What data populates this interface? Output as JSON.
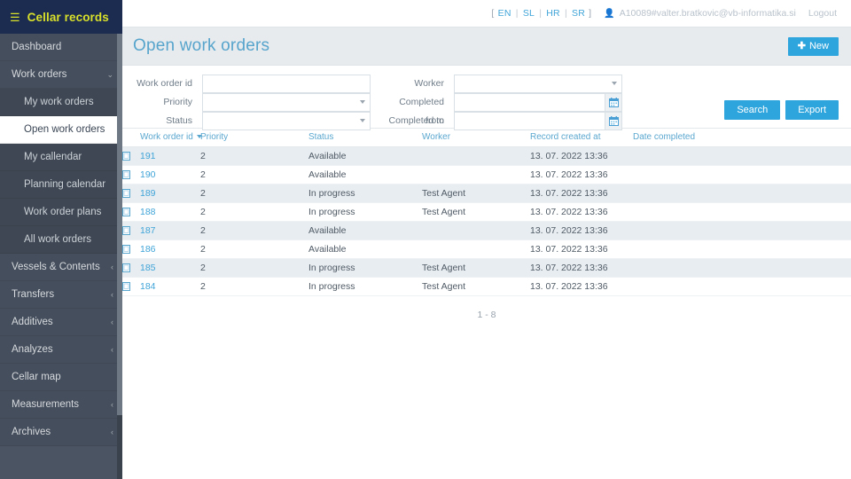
{
  "brand": {
    "menu_icon": "hamburger-icon",
    "title": "Cellar records",
    "color": "#d9e02a",
    "bg": "#1b2c50"
  },
  "sidebar": {
    "bg": "#4a5463",
    "active_bg": "#ffffff",
    "items": [
      {
        "label": "Dashboard",
        "level": 1,
        "caret": "",
        "active": false
      },
      {
        "label": "Work orders",
        "level": 1,
        "caret": "⌄",
        "active": false
      },
      {
        "label": "My work orders",
        "level": 2,
        "caret": "",
        "active": false
      },
      {
        "label": "Open work orders",
        "level": 2,
        "caret": "",
        "active": true
      },
      {
        "label": "My callendar",
        "level": 2,
        "caret": "",
        "active": false
      },
      {
        "label": "Planning calendar",
        "level": 2,
        "caret": "",
        "active": false
      },
      {
        "label": "Work order plans",
        "level": 2,
        "caret": "",
        "active": false
      },
      {
        "label": "All work orders",
        "level": 2,
        "caret": "",
        "active": false
      },
      {
        "label": "Vessels & Contents",
        "level": 1,
        "caret": "‹",
        "active": false
      },
      {
        "label": "Transfers",
        "level": 1,
        "caret": "‹",
        "active": false
      },
      {
        "label": "Additives",
        "level": 1,
        "caret": "‹",
        "active": false
      },
      {
        "label": "Analyzes",
        "level": 1,
        "caret": "‹",
        "active": false
      },
      {
        "label": "Cellar map",
        "level": 1,
        "caret": "",
        "active": false
      },
      {
        "label": "Measurements",
        "level": 1,
        "caret": "‹",
        "active": false
      },
      {
        "label": "Archives",
        "level": 1,
        "caret": "‹",
        "active": false
      }
    ]
  },
  "topbar": {
    "bracket_open": "[",
    "bracket_close": "]",
    "separator": "|",
    "languages": [
      "EN",
      "SL",
      "HR",
      "SR"
    ],
    "user_icon": "user-icon",
    "username": "A10089#valter.bratkovic@vb-informatika.si",
    "logout_label": "Logout",
    "link_color": "#3fa4d8"
  },
  "page": {
    "title": "Open work orders",
    "title_color": "#57a4cc",
    "new_button": {
      "icon": "plus-icon",
      "label": "New"
    },
    "header_bg": "#e7ebee",
    "accent": "#2fa5dd"
  },
  "filters": {
    "work_order_id": {
      "label": "Work order id",
      "value": "",
      "placeholder": ""
    },
    "priority": {
      "label": "Priority",
      "value": "",
      "placeholder": "",
      "options": [
        ""
      ]
    },
    "status": {
      "label": "Status",
      "value": "",
      "placeholder": "",
      "options": [
        ""
      ]
    },
    "worker": {
      "label": "Worker",
      "value": "",
      "placeholder": "",
      "options": [
        ""
      ]
    },
    "completed_from": {
      "label": "Completed from",
      "value": "",
      "placeholder": "",
      "icon": "calendar-icon"
    },
    "completed_to": {
      "label": "Completed to",
      "value": "",
      "placeholder": "",
      "icon": "calendar-icon"
    },
    "search_label": "Search",
    "export_label": "Export"
  },
  "table": {
    "columns": [
      "Work order id",
      "Priority",
      "Status",
      "Worker",
      "Record created at",
      "Date completed"
    ],
    "sorted_column": "Work order id",
    "sort_direction": "desc",
    "row_icon": "document-icon",
    "rows": [
      {
        "id": "191",
        "priority": "2",
        "status": "Available",
        "worker": "",
        "created": "13. 07. 2022 13:36",
        "completed": ""
      },
      {
        "id": "190",
        "priority": "2",
        "status": "Available",
        "worker": "",
        "created": "13. 07. 2022 13:36",
        "completed": ""
      },
      {
        "id": "189",
        "priority": "2",
        "status": "In progress",
        "worker": "Test Agent",
        "created": "13. 07. 2022 13:36",
        "completed": ""
      },
      {
        "id": "188",
        "priority": "2",
        "status": "In progress",
        "worker": "Test Agent",
        "created": "13. 07. 2022 13:36",
        "completed": ""
      },
      {
        "id": "187",
        "priority": "2",
        "status": "Available",
        "worker": "",
        "created": "13. 07. 2022 13:36",
        "completed": ""
      },
      {
        "id": "186",
        "priority": "2",
        "status": "Available",
        "worker": "",
        "created": "13. 07. 2022 13:36",
        "completed": ""
      },
      {
        "id": "185",
        "priority": "2",
        "status": "In progress",
        "worker": "Test Agent",
        "created": "13. 07. 2022 13:36",
        "completed": ""
      },
      {
        "id": "184",
        "priority": "2",
        "status": "In progress",
        "worker": "Test Agent",
        "created": "13. 07. 2022 13:36",
        "completed": ""
      }
    ],
    "pager_text": "1 - 8"
  }
}
